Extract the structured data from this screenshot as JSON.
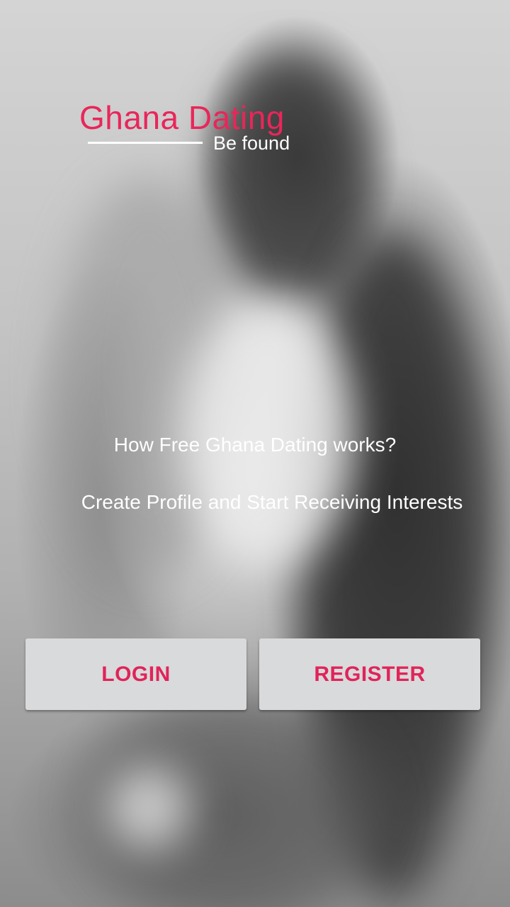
{
  "app": {
    "logo_title": "Ghana Dating",
    "logo_tagline": "Be found"
  },
  "intro": {
    "question": "How Free Ghana Dating works?",
    "answer": "Create Profile and Start Receiving Interests"
  },
  "actions": {
    "login_label": "LOGIN",
    "register_label": "REGISTER"
  },
  "colors": {
    "brand_pink": "#e8265a",
    "button_bg": "#d9dadb",
    "text_white": "#ffffff"
  }
}
